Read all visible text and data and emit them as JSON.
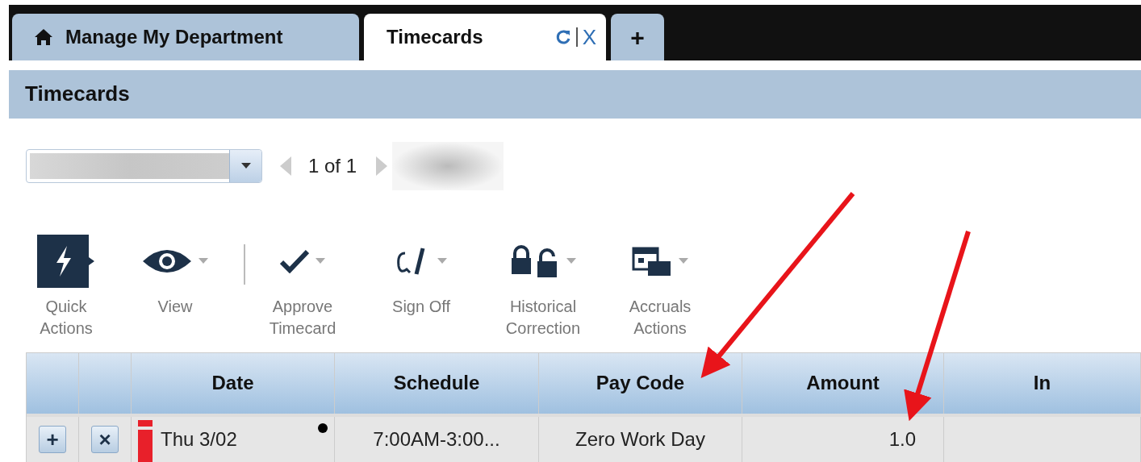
{
  "tabs": [
    {
      "kind": "home",
      "label": "Manage My Department",
      "selected": false
    },
    {
      "kind": "page",
      "label": "Timecards",
      "selected": true,
      "close": "X"
    },
    {
      "kind": "add",
      "label": "+",
      "selected": false
    }
  ],
  "page_title": "Timecards",
  "pager": {
    "text": "1 of 1"
  },
  "actions": [
    {
      "kind": "quick",
      "label": "Quick Actions"
    },
    {
      "kind": "menu",
      "label": "View"
    },
    {
      "kind": "menu",
      "label": "Approve Timecard"
    },
    {
      "kind": "menu",
      "label": "Sign Off"
    },
    {
      "kind": "menu",
      "label": "Historical Correction"
    },
    {
      "kind": "menu",
      "label": "Accruals Actions"
    }
  ],
  "table": {
    "columns": [
      "",
      "",
      "Date",
      "Schedule",
      "Pay Code",
      "Amount",
      "In"
    ],
    "rows": [
      {
        "add": "+",
        "remove": "×",
        "date": "Thu 3/02",
        "schedule": "7:00AM-3:00...",
        "pay_code": "Zero Work Day",
        "amount": "1.0"
      }
    ]
  }
}
